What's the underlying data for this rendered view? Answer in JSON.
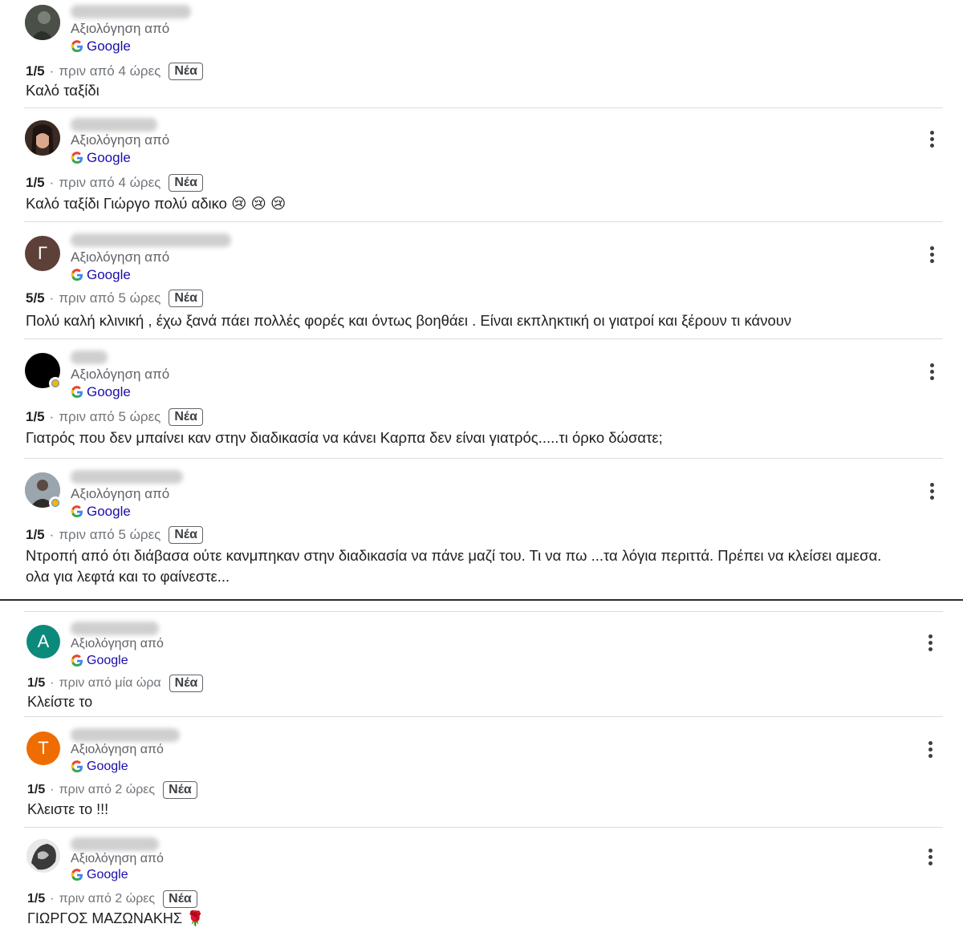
{
  "reviews": [
    {
      "avatar_letter": "",
      "avatar_kind": "photo-dark",
      "by_label": "Αξιολόγηση από",
      "source": "Google",
      "score": "1/5",
      "time": "πριν από 4 ώρες",
      "badge": "Νέα",
      "text": "Καλό ταξίδι",
      "has_menu": false
    },
    {
      "avatar_letter": "",
      "avatar_kind": "photo-woman",
      "by_label": "Αξιολόγηση από",
      "source": "Google",
      "score": "1/5",
      "time": "πριν από 4 ώρες",
      "badge": "Νέα",
      "text": "Καλό ταξίδι Γιώργο πολύ αδικο 😢 😢 😢",
      "has_menu": true
    },
    {
      "avatar_letter": "Γ",
      "avatar_kind": "letter",
      "avatar_color": "#5d4037",
      "by_label": "Αξιολόγηση από",
      "source": "Google",
      "score": "5/5",
      "time": "πριν από 5 ώρες",
      "badge": "Νέα",
      "text": "Πολύ καλή κλινική , έχω ξανά πάει πολλές φορές και όντως βοηθάει . Είναι εκπληκτική οι γιατροί και ξέρουν τι κάνουν",
      "has_menu": true
    },
    {
      "avatar_letter": "",
      "avatar_kind": "black",
      "by_label": "Αξιολόγηση από",
      "source": "Google",
      "score": "1/5",
      "time": "πριν από 5 ώρες",
      "badge": "Νέα",
      "text": "Γιατρός που δεν μπαίνει καν στην διαδικασία να κάνει Καρπα δεν είναι γιατρός.....τι όρκο δώσατε;",
      "has_menu": true
    },
    {
      "avatar_letter": "",
      "avatar_kind": "photo-man",
      "by_label": "Αξιολόγηση από",
      "source": "Google",
      "score": "1/5",
      "time": "πριν από 5 ώρες",
      "badge": "Νέα",
      "text": "Ντροπή από ότι διάβασα ούτε κανμπηκαν στην διαδικασία να πάνε μαζί του. Τι να πω ...τα λόγια περιττά. Πρέπει να κλείσει αμεσα.",
      "text2": "ολα για λεφτά και το φαίνεστε...",
      "has_menu": true
    },
    {
      "avatar_letter": "A",
      "avatar_kind": "letter",
      "avatar_color": "#0b8a7c",
      "by_label": "Αξιολόγηση από",
      "source": "Google",
      "score": "1/5",
      "time": "πριν από μία ώρα",
      "badge": "Νέα",
      "text": "Κλείστε το",
      "has_menu": true
    },
    {
      "avatar_letter": "T",
      "avatar_kind": "letter",
      "avatar_color": "#ef6c00",
      "by_label": "Αξιολόγηση από",
      "source": "Google",
      "score": "1/5",
      "time": "πριν από 2 ώρες",
      "badge": "Νέα",
      "text": "Κλειστε το !!!",
      "has_menu": true
    },
    {
      "avatar_letter": "",
      "avatar_kind": "photo-bw",
      "by_label": "Αξιολόγηση από",
      "source": "Google",
      "score": "1/5",
      "time": "πριν από 2 ώρες",
      "badge": "Νέα",
      "text": "ΓΙΩΡΓΟΣ ΜΑΖΩΝΑΚΗΣ 🌹",
      "has_menu": true
    }
  ]
}
